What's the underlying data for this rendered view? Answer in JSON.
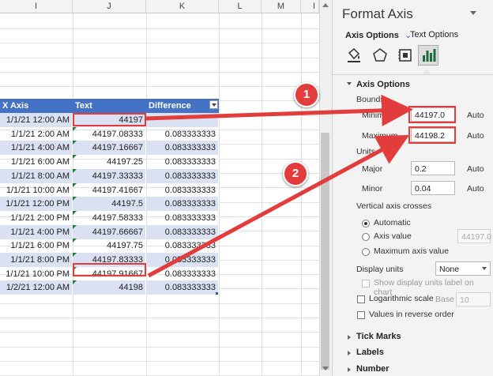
{
  "columns": [
    "I",
    "J",
    "K",
    "L",
    "M",
    "I"
  ],
  "table": {
    "headers": [
      "X Axis",
      "Text",
      "Difference"
    ],
    "rows": [
      [
        "1/1/21 12:00 AM",
        "44197",
        ""
      ],
      [
        "1/1/21 2:00 AM",
        "44197.08333",
        "0.083333333"
      ],
      [
        "1/1/21 4:00 AM",
        "44197.16667",
        "0.083333333"
      ],
      [
        "1/1/21 6:00 AM",
        "44197.25",
        "0.083333333"
      ],
      [
        "1/1/21 8:00 AM",
        "44197.33333",
        "0.083333333"
      ],
      [
        "1/1/21 10:00 AM",
        "44197.41667",
        "0.083333333"
      ],
      [
        "1/1/21 12:00 PM",
        "44197.5",
        "0.083333333"
      ],
      [
        "1/1/21 2:00 PM",
        "44197.58333",
        "0.083333333"
      ],
      [
        "1/1/21 4:00 PM",
        "44197.66667",
        "0.083333333"
      ],
      [
        "1/1/21 6:00 PM",
        "44197.75",
        "0.083333333"
      ],
      [
        "1/1/21 8:00 PM",
        "44197.83333",
        "0.083333333"
      ],
      [
        "1/1/21 10:00 PM",
        "44197.91667",
        "0.083333333"
      ],
      [
        "1/2/21 12:00 AM",
        "44198",
        "0.083333333"
      ]
    ]
  },
  "pane": {
    "title": "Format Axis",
    "tab_axis_options": "Axis Options",
    "tab_text_options": "Text Options",
    "section_axis_options": "Axis Options",
    "bounds_label": "Bounds",
    "minimum_label": "Minimum",
    "minimum_value": "44197.0",
    "maximum_label": "Maximum",
    "maximum_value": "44198.2",
    "auto": "Auto",
    "units_label": "Units",
    "major_label": "Major",
    "major_value": "0.2",
    "minor_label": "Minor",
    "minor_value": "0.04",
    "crosses_label": "Vertical axis crosses",
    "automatic": "Automatic",
    "axis_value": "Axis value",
    "axis_value_input": "44197.0",
    "max_axis_value": "Maximum axis value",
    "display_units_label": "Display units",
    "display_units_value": "None",
    "show_units_label": "Show display units label on chart",
    "log_scale": "Logarithmic scale",
    "base_label": "Base",
    "base_value": "10",
    "reverse_order": "Values in reverse order",
    "tick_marks": "Tick Marks",
    "labels": "Labels",
    "number": "Number"
  },
  "callouts": [
    "1",
    "2"
  ],
  "colors": {
    "accent": "#e23c3c",
    "table_header": "#4472c4",
    "band": "#d9e1f2",
    "tab_underline": "#1f6b3a"
  },
  "icons": [
    "fill-line-icon",
    "effects-icon",
    "size-properties-icon",
    "axis-options-icon"
  ]
}
